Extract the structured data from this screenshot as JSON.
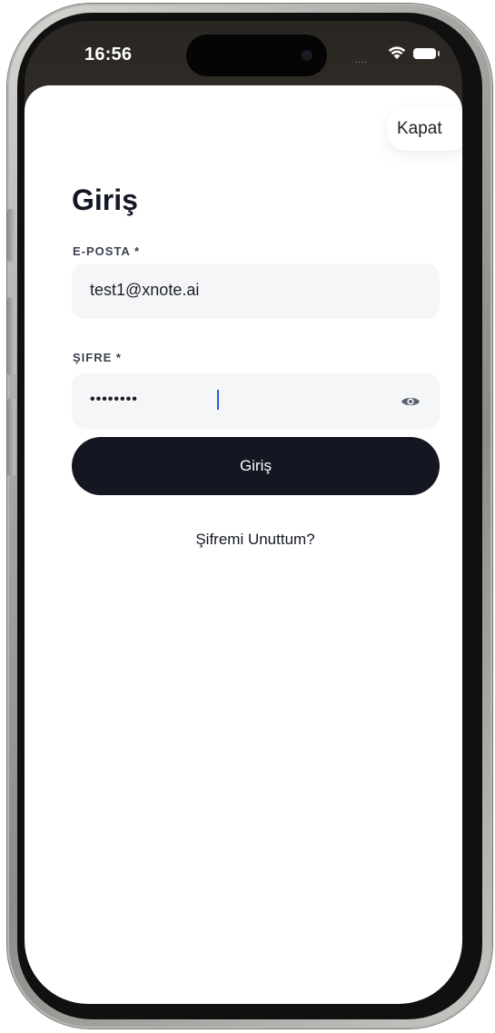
{
  "status_bar": {
    "time": "16:56",
    "signal_dots": "....",
    "wifi_icon": "wifi-icon",
    "battery_icon": "battery-icon"
  },
  "header": {
    "close_label": "Kapat"
  },
  "form": {
    "title": "Giriş",
    "email": {
      "label": "E-POSTA *",
      "value": "test1@xnote.ai"
    },
    "password": {
      "label": "ŞIFRE *",
      "masked_value": "••••••••",
      "toggle_icon": "eye-icon"
    },
    "submit_label": "Giriş",
    "forgot_label": "Şifremi Unuttum?"
  },
  "colors": {
    "primary_button": "#141621",
    "input_background": "#f5f6f8",
    "caret": "#2b5bd7"
  }
}
